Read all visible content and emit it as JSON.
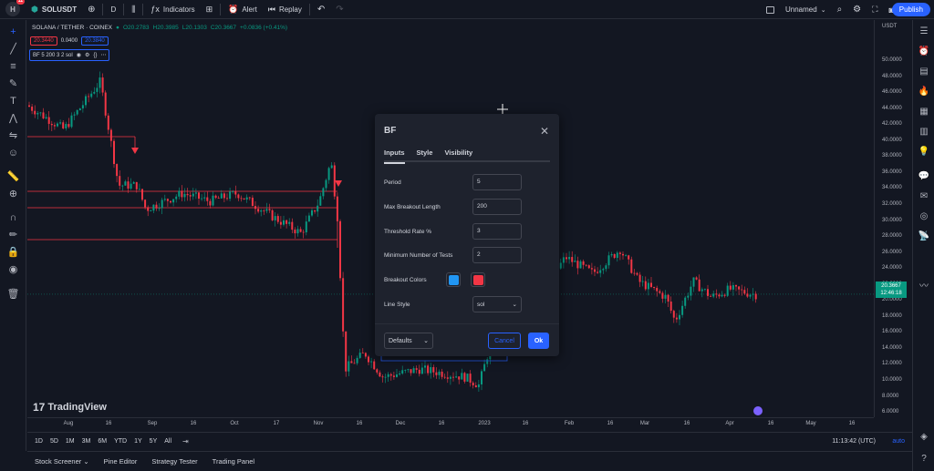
{
  "topbar": {
    "logo_letter": "H",
    "logo_badge": "11",
    "symbol": "SOLUSDT",
    "interval": "D",
    "indicators_label": "Indicators",
    "alert_label": "Alert",
    "replay_label": "Replay",
    "layout_name": "Unnamed",
    "publish_label": "Publish"
  },
  "legend": {
    "title": "SOLANA / TETHER · COINEX",
    "open": "O20.2783",
    "high": "H20.3985",
    "low": "L20.1303",
    "close": "C20.3667",
    "change": "+0.0836 (+0.41%)",
    "bid": "20.3440",
    "spread": "0.0400",
    "ask": "20.3840",
    "indicator": "BF 5 200 3 2 sol"
  },
  "price_axis": {
    "currency": "USDT",
    "ticks": [
      "50.0000",
      "48.0000",
      "46.0000",
      "44.0000",
      "42.0000",
      "40.0000",
      "38.0000",
      "36.0000",
      "34.0000",
      "32.0000",
      "30.0000",
      "28.0000",
      "26.0000",
      "24.0000",
      "22.0000",
      "20.0000",
      "18.0000",
      "16.0000",
      "14.0000",
      "12.0000",
      "10.0000",
      "8.0000",
      "6.0000"
    ],
    "last_price": "20.3667",
    "countdown": "12:46:18"
  },
  "time_axis": {
    "ticks": [
      "Aug",
      "16",
      "Sep",
      "16",
      "Oct",
      "17",
      "Nov",
      "16",
      "Dec",
      "16",
      "2023",
      "16",
      "Feb",
      "16",
      "Mar",
      "16",
      "Apr",
      "16",
      "May",
      "16"
    ]
  },
  "range_bar": {
    "ranges": [
      "1D",
      "5D",
      "1M",
      "3M",
      "6M",
      "YTD",
      "1Y",
      "5Y",
      "All"
    ],
    "clock": "11:13:42 (UTC)",
    "auto_label": "auto"
  },
  "bottom_tabs": [
    "Stock Screener",
    "Pine Editor",
    "Strategy Tester",
    "Trading Panel"
  ],
  "branding": {
    "name": "TradingView",
    "mark": "17"
  },
  "dialog": {
    "title": "BF",
    "tabs": [
      "Inputs",
      "Style",
      "Visibility"
    ],
    "period_label": "Period",
    "period_value": "5",
    "max_breakout_label": "Max Breakout Length",
    "max_breakout_value": "200",
    "threshold_label": "Threshold Rate %",
    "threshold_value": "3",
    "min_tests_label": "Minimum Number of Tests",
    "min_tests_value": "2",
    "breakout_colors_label": "Breakout Colors",
    "breakout_color_up": "#2196f3",
    "breakout_color_down": "#f23645",
    "line_style_label": "Line Style",
    "line_style_value": "sol",
    "defaults_label": "Defaults",
    "cancel_label": "Cancel",
    "ok_label": "Ok"
  },
  "colors": {
    "up": "#089981",
    "down": "#f23645",
    "accent": "#2962ff",
    "background": "#131722"
  }
}
